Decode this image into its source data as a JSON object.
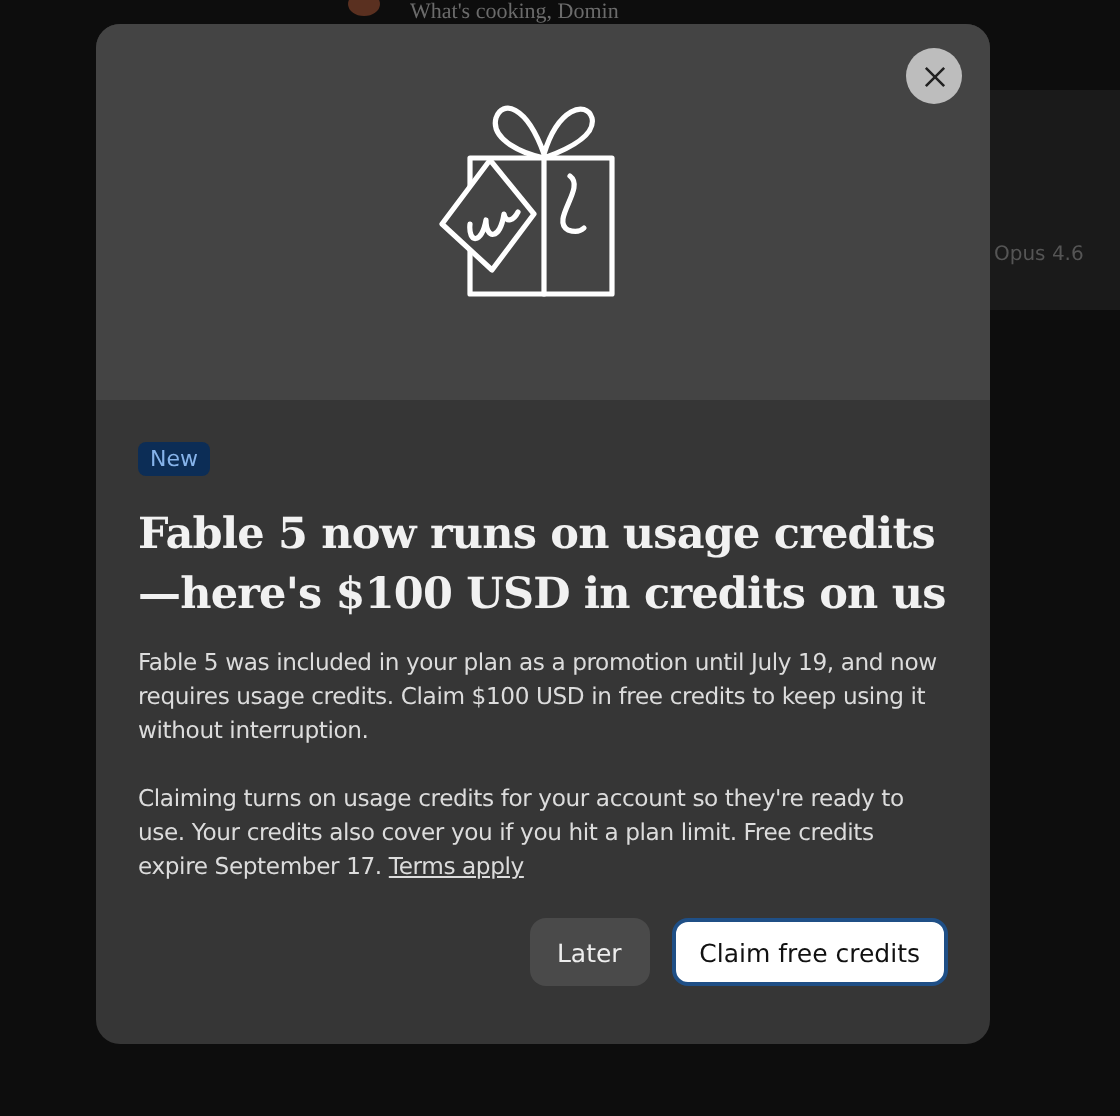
{
  "background": {
    "greeting": "What's cooking, Domin",
    "model": "Opus 4.6"
  },
  "dialog": {
    "badge": "New",
    "title": "Fable 5 now runs on usage credits —here's $100 USD in credits on us",
    "paragraphs": [
      "Fable 5 was included in your plan as a promotion until July 19, and now requires usage credits. Claim $100 USD in free credits to keep using it without interruption.",
      "Claiming turns on usage credits for your account so they're ready to use. Your credits also cover you if you hit a plan limit. Free credits expire September 17."
    ],
    "terms_link": "Terms apply",
    "buttons": [
      {
        "label": "Later",
        "kind": "secondary"
      },
      {
        "label": "Claim free credits",
        "kind": "primary"
      }
    ]
  }
}
